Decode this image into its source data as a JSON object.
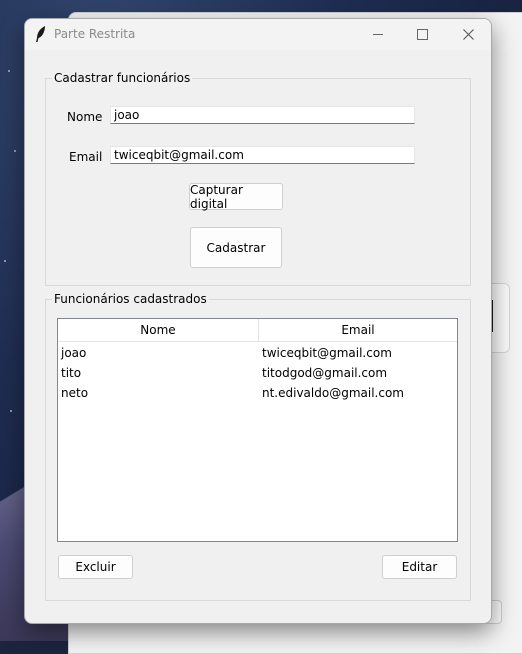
{
  "window": {
    "title": "Parte Restrita"
  },
  "form": {
    "section_title": "Cadastrar funcionários",
    "name_label": "Nome",
    "name_value": "joao",
    "email_label": "Email",
    "email_value": "twiceqbit@gmail.com",
    "capture_button": "Capturar digital",
    "register_button": "Cadastrar"
  },
  "list": {
    "section_title": "Funcionários cadastrados",
    "columns": [
      "Nome",
      "Email"
    ],
    "rows": [
      {
        "name": "joao",
        "email": "twiceqbit@gmail.com"
      },
      {
        "name": "tito",
        "email": "titodgod@gmail.com"
      },
      {
        "name": "neto",
        "email": "nt.edivaldo@gmail.com"
      }
    ],
    "delete_button": "Excluir",
    "edit_button": "Editar"
  }
}
